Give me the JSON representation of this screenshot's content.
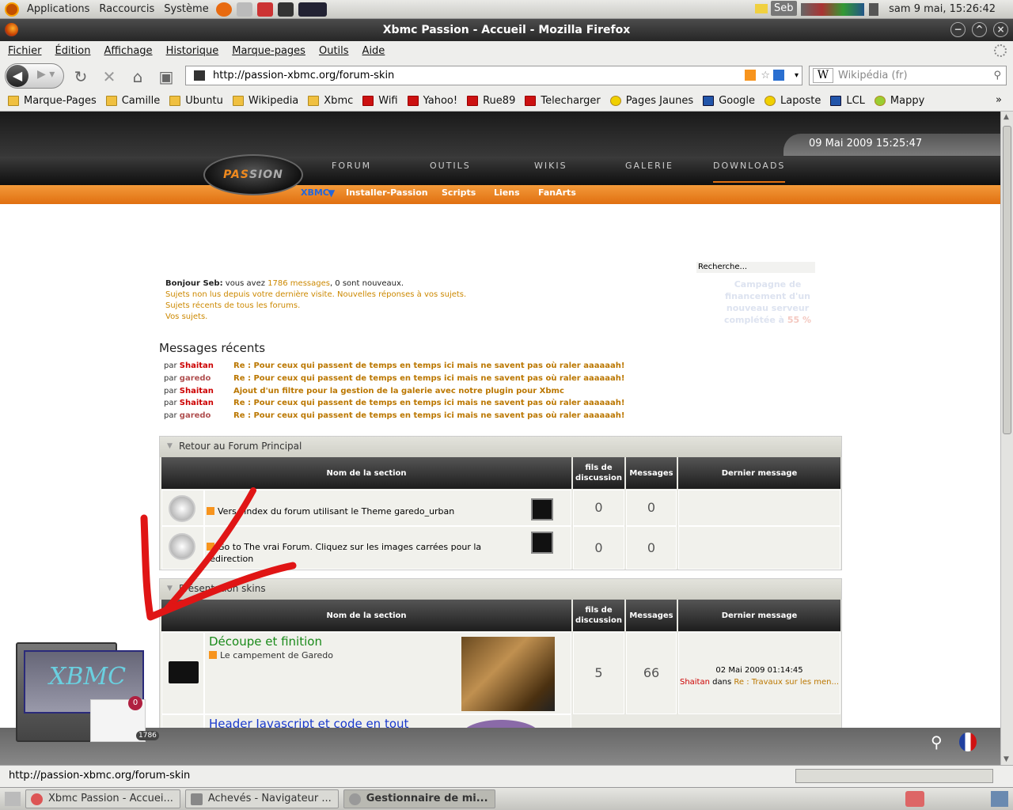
{
  "panel": {
    "menus": [
      "Applications",
      "Raccourcis",
      "Système"
    ],
    "user": "Seb",
    "clock": "sam  9 mai, 15:26:42"
  },
  "window": {
    "title": "Xbmc Passion - Accueil - Mozilla Firefox"
  },
  "menubar": [
    "Fichier",
    "Édition",
    "Affichage",
    "Historique",
    "Marque-pages",
    "Outils",
    "Aide"
  ],
  "nav": {
    "url": "http://passion-xbmc.org/forum-skin",
    "search_placeholder": "Wikipédia (fr)"
  },
  "bookmarks": [
    "Marque-Pages",
    "Camille",
    "Ubuntu",
    "Wikipedia",
    "Xbmc",
    "Wifi",
    "Yahoo!",
    "Rue89",
    "Telecharger",
    "Pages Jaunes",
    "Google",
    "Laposte",
    "LCL",
    "Mappy"
  ],
  "site": {
    "date": "09 Mai 2009 15:25:47",
    "logo": {
      "pas": "PAS",
      "sion": "SION"
    },
    "topnav": [
      "FORUM",
      "OUTILS",
      "WIKIS",
      "GALERIE",
      "DOWNLOADS"
    ],
    "subnav": [
      "XBMC",
      "Installer-Passion",
      "Scripts",
      "Liens",
      "FanArts"
    ],
    "search_placeholder": "Recherche...",
    "campaign": {
      "text": "Campagne de financement d'un nouveau serveur complétée à",
      "pct": "55 %"
    },
    "greeting": {
      "hello": "Bonjour Seb:",
      "pre": " vous avez ",
      "count": "1786 messages",
      "post": ", 0 sont nouveaux.",
      "line2": "Sujets non lus depuis votre dernière visite. Nouvelles réponses à vos sujets.",
      "line3": "Sujets récents de tous les forums.",
      "line4": "Vos sujets."
    },
    "recent_title": "Messages récents",
    "recent": [
      {
        "by": "par",
        "user": "Shaitan",
        "topic": "Re : Pour ceux qui passent de temps en temps ici mais ne savent pas où raler aaaaaah!"
      },
      {
        "by": "par",
        "user": "garedo",
        "topic": "Re : Pour ceux qui passent de temps en temps ici mais ne savent pas où raler aaaaaah!"
      },
      {
        "by": "par",
        "user": "Shaitan",
        "topic": "Ajout d'un filtre pour la gestion de la galerie avec notre plugin pour Xbmc"
      },
      {
        "by": "par",
        "user": "Shaitan",
        "topic": "Re : Pour ceux qui passent de temps en temps ici mais ne savent pas où raler aaaaaah!"
      },
      {
        "by": "par",
        "user": "garedo",
        "topic": "Re : Pour ceux qui passent de temps en temps ici mais ne savent pas où raler aaaaaah!"
      }
    ],
    "cols": [
      "Nom de la section",
      "fils de discussion",
      "Messages",
      "Dernier message"
    ],
    "cat1": {
      "title": "Retour au Forum Principal",
      "rows": [
        {
          "text": "Vers l'index du forum utilisant le Theme garedo_urban",
          "topics": "0",
          "posts": "0"
        },
        {
          "text": "Go to The vrai Forum. Cliquez sur les images carrées pour la redirection",
          "topics": "0",
          "posts": "0"
        }
      ]
    },
    "cat2": {
      "title": "Présentation skins",
      "rows": [
        {
          "name": "Découpe et finition",
          "desc": "Le campement de Garedo",
          "topics": "5",
          "posts": "66",
          "last_date": "02 Mai 2009 01:14:45",
          "last_user": "Shaitan",
          "last_in": "dans",
          "last_topic": "Re : Travaux sur les men..."
        },
        {
          "name": "Header Javascript et code en tout"
        }
      ]
    }
  },
  "widget": {
    "unread": "0",
    "total": "1786"
  },
  "statusbar": "http://passion-xbmc.org/forum-skin",
  "taskbar": [
    "Xbmc Passion - Accuei...",
    "Achevés - Navigateur ...",
    "Gestionnaire de mi..."
  ]
}
